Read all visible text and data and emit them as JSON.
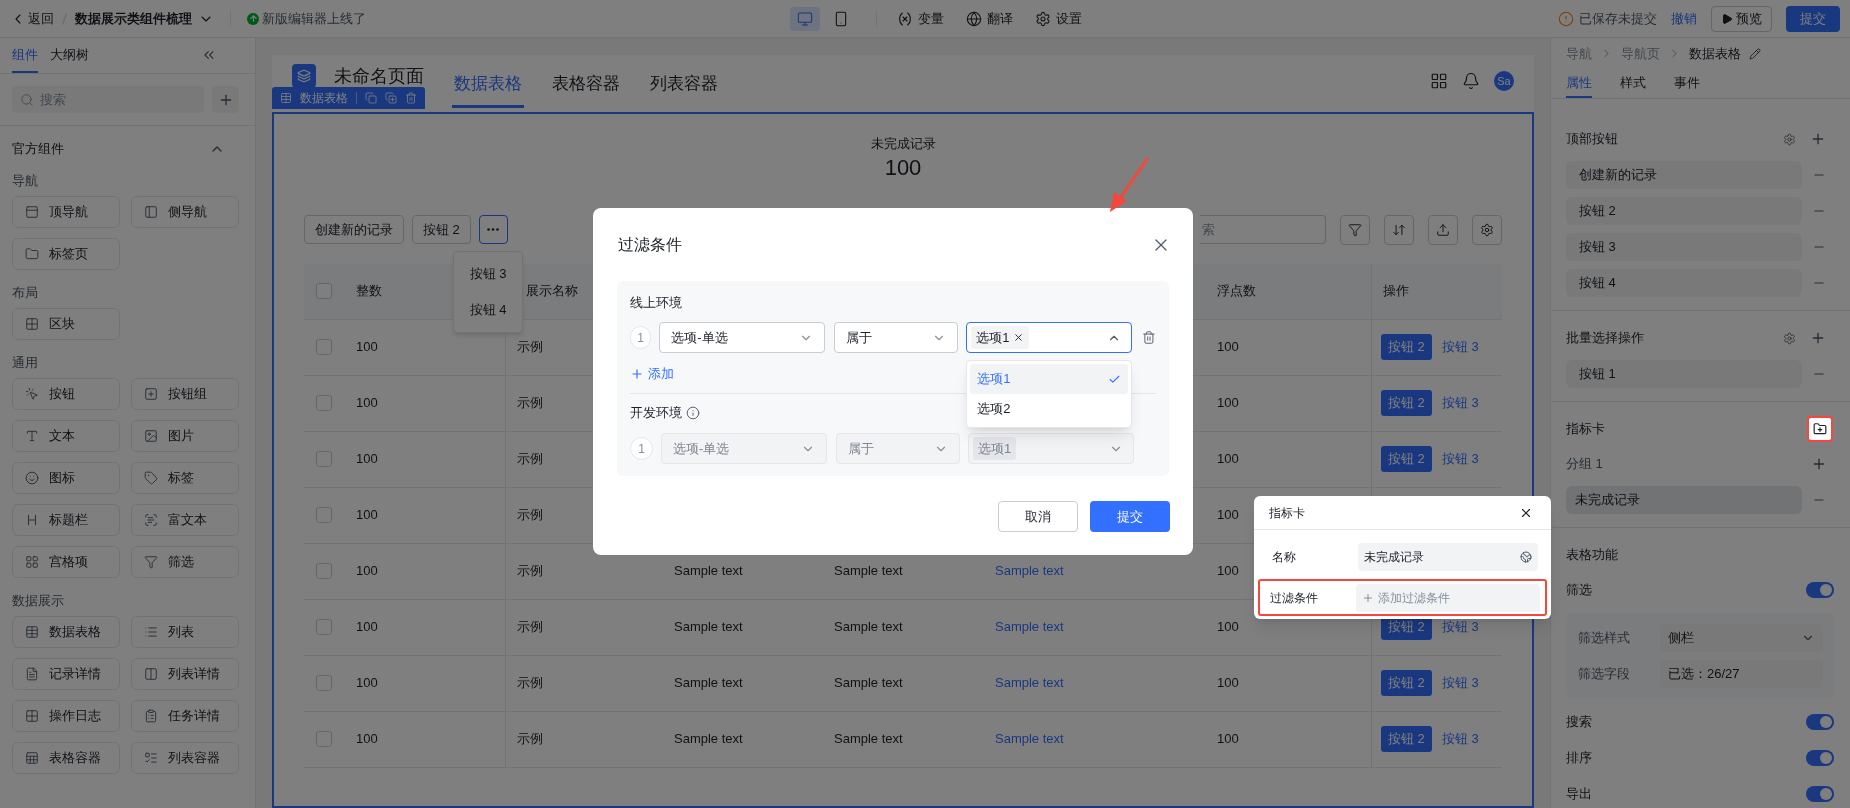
{
  "top_bar": {
    "back": "返回",
    "project": "数据展示类组件梳理",
    "notice": "新版编辑器上线了",
    "devices": [
      {
        "selected": true
      },
      {
        "selected": false
      }
    ],
    "tools": [
      "变量",
      "翻译",
      "设置"
    ],
    "save_status": "已保存未提交",
    "undo": "撤销",
    "preview": "预览",
    "submit": "提交"
  },
  "sidebar": {
    "tabs": [
      {
        "label": "组件",
        "selected": true
      },
      {
        "label": "大纲树",
        "selected": false
      }
    ],
    "search": {
      "placeholder": "搜索"
    },
    "section": {
      "title": "官方组件",
      "expanded": true
    },
    "groups": [
      {
        "title": "导航",
        "items": [
          "顶导航",
          "侧导航",
          "标签页"
        ]
      },
      {
        "title": "布局",
        "items": [
          "区块"
        ]
      },
      {
        "title": "通用",
        "items": [
          "按钮",
          "按钮组",
          "文本",
          "图片",
          "图标",
          "标签",
          "标题栏",
          "富文本",
          "宫格项",
          "筛选"
        ]
      },
      {
        "title": "数据展示",
        "items": [
          "数据表格",
          "列表",
          "记录详情",
          "列表详情",
          "操作日志",
          "任务详情",
          "表格容器",
          "列表容器"
        ]
      }
    ]
  },
  "canvas": {
    "page_title": "未命名页面",
    "nav_tabs": [
      {
        "label": "数据表格",
        "selected": true
      },
      {
        "label": "表格容器",
        "selected": false
      },
      {
        "label": "列表容器",
        "selected": false
      }
    ],
    "avatar": "Sa",
    "selection_toolbar": "数据表格",
    "metric": {
      "label": "未完成记录",
      "value": "100"
    },
    "toolbar_buttons": [
      "创建新的记录",
      "按钮 2"
    ],
    "more_menu": {
      "open": true,
      "items": [
        "按钮 3",
        "按钮 4"
      ]
    },
    "search": {
      "placeholder": "索"
    },
    "table": {
      "header_checkbox": {
        "checked": false
      },
      "columns": {
        "integer": "整数",
        "name": "展示名称",
        "float": "浮点数",
        "actions": "操作"
      },
      "rows": [
        {
          "checked": false,
          "integer": "100",
          "name": "示例",
          "float": "100",
          "actions": [
            {
              "label": "按钮 2",
              "kind": "primary"
            },
            {
              "label": "按钮 3",
              "kind": "link"
            }
          ]
        },
        {
          "checked": false,
          "integer": "100",
          "name": "示例",
          "float": "100",
          "actions": [
            {
              "label": "按钮 2",
              "kind": "primary"
            },
            {
              "label": "按钮 3",
              "kind": "link"
            }
          ]
        },
        {
          "checked": false,
          "integer": "100",
          "name": "示例",
          "float": "100",
          "actions": [
            {
              "label": "按钮 2",
              "kind": "primary"
            },
            {
              "label": "按钮 3",
              "kind": "link"
            }
          ]
        },
        {
          "checked": false,
          "integer": "100",
          "name": "示例",
          "float": "100"
        },
        {
          "checked": false,
          "integer": "100",
          "name": "示例",
          "column_3": "Sample text",
          "column_4": "Sample text",
          "column_5": "Sample text",
          "float": "100"
        },
        {
          "checked": false,
          "integer": "100",
          "name": "示例",
          "column_3": "Sample text",
          "column_4": "Sample text",
          "column_5": "Sample text",
          "float": "100",
          "actions": [
            {
              "label": "按钮 2",
              "kind": "primary"
            },
            {
              "label": "按钮 3",
              "kind": "link"
            }
          ]
        },
        {
          "checked": false,
          "integer": "100",
          "name": "示例",
          "column_3": "Sample text",
          "column_4": "Sample text",
          "column_5": "Sample text",
          "float": "100",
          "actions": [
            {
              "label": "按钮 2",
              "kind": "primary"
            },
            {
              "label": "按钮 3",
              "kind": "link"
            }
          ]
        },
        {
          "checked": false,
          "integer": "100",
          "name": "示例",
          "column_3": "Sample text",
          "column_4": "Sample text",
          "column_5": "Sample text",
          "float": "100",
          "actions": [
            {
              "label": "按钮 2",
              "kind": "primary"
            },
            {
              "label": "按钮 3",
              "kind": "link"
            }
          ]
        }
      ]
    }
  },
  "properties_panel": {
    "breadcrumb": [
      "导航",
      "导航页",
      "数据表格"
    ],
    "tabs": [
      {
        "label": "属性",
        "selected": true
      },
      {
        "label": "样式",
        "selected": false
      },
      {
        "label": "事件",
        "selected": false
      }
    ],
    "top_buttons": {
      "title": "顶部按钮",
      "items": [
        "创建新的记录",
        "按钮 2",
        "按钮 3",
        "按钮 4"
      ]
    },
    "batch_actions": {
      "title": "批量选择操作",
      "items": [
        "按钮 1"
      ]
    },
    "metric_cards": {
      "title": "指标卡",
      "highlighted": true,
      "groups": [
        {
          "name": "分组 1",
          "items": [
            {
              "label": "未完成记录",
              "selected": true
            }
          ]
        }
      ]
    },
    "table_features": {
      "title": "表格功能",
      "filter": {
        "label": "筛选",
        "on": true
      },
      "filter_options": [
        {
          "label": "筛选样式",
          "value": "侧栏",
          "kind": "select"
        },
        {
          "label": "筛选字段",
          "value": "已选：26/27",
          "kind": "text"
        }
      ],
      "toggles": [
        {
          "label": "搜索",
          "on": true
        },
        {
          "label": "排序",
          "on": true
        },
        {
          "label": "导出",
          "on": true
        }
      ]
    }
  },
  "metric_card_popover": {
    "title": "指标卡",
    "fields": [
      {
        "label": "名称",
        "value": "未完成记录",
        "kind": "text",
        "highlighted": false
      },
      {
        "label": "过滤条件",
        "placeholder": "添加过滤条件",
        "kind": "add",
        "highlighted": true
      }
    ]
  },
  "filter_dialog": {
    "title": "过滤条件",
    "environments": [
      {
        "title": "线上环境",
        "info": false,
        "disabled": false,
        "add": "添加",
        "conditions": [
          {
            "index": "1",
            "field": "选项-单选",
            "operator": "属于",
            "values": [
              "选项1"
            ],
            "open": true,
            "options": [
              {
                "label": "选项1",
                "selected": true
              },
              {
                "label": "选项2",
                "selected": false
              }
            ]
          }
        ]
      },
      {
        "title": "开发环境",
        "info": true,
        "disabled": true,
        "conditions": [
          {
            "index": "1",
            "field": "选项-单选",
            "operator": "属于",
            "values": [
              "选项1"
            ],
            "open": false
          }
        ]
      }
    ],
    "cancel": "取消",
    "submit": "提交"
  }
}
